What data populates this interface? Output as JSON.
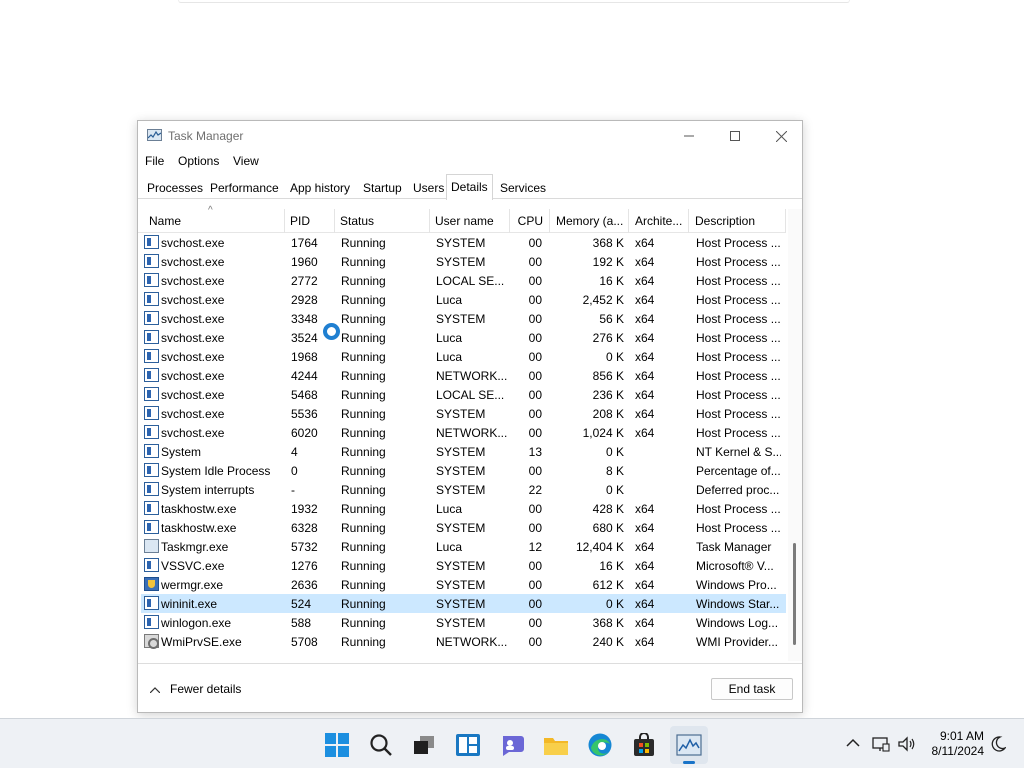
{
  "window": {
    "title": "Task Manager",
    "caption_buttons": [
      "minimize",
      "maximize",
      "close"
    ]
  },
  "menu": [
    "File",
    "Options",
    "View"
  ],
  "tabs": [
    {
      "label": "Processes"
    },
    {
      "label": "Performance"
    },
    {
      "label": "App history"
    },
    {
      "label": "Startup"
    },
    {
      "label": "Users"
    },
    {
      "label": "Details",
      "active": true
    },
    {
      "label": "Services"
    }
  ],
  "columns": [
    "Name",
    "PID",
    "Status",
    "User name",
    "CPU",
    "Memory (a...",
    "Archite...",
    "Description"
  ],
  "rows": [
    {
      "name": "svchost.exe",
      "pid": "1764",
      "status": "Running",
      "user": "SYSTEM",
      "cpu": "00",
      "memory": "368 K",
      "arch": "x64",
      "desc": "Host Process ...",
      "icon": "window-icon"
    },
    {
      "name": "svchost.exe",
      "pid": "1960",
      "status": "Running",
      "user": "SYSTEM",
      "cpu": "00",
      "memory": "192 K",
      "arch": "x64",
      "desc": "Host Process ...",
      "icon": "window-icon"
    },
    {
      "name": "svchost.exe",
      "pid": "2772",
      "status": "Running",
      "user": "LOCAL SE...",
      "cpu": "00",
      "memory": "16 K",
      "arch": "x64",
      "desc": "Host Process ...",
      "icon": "window-icon"
    },
    {
      "name": "svchost.exe",
      "pid": "2928",
      "status": "Running",
      "user": "Luca",
      "cpu": "00",
      "memory": "2,452 K",
      "arch": "x64",
      "desc": "Host Process ...",
      "icon": "window-icon"
    },
    {
      "name": "svchost.exe",
      "pid": "3348",
      "status": "Running",
      "user": "SYSTEM",
      "cpu": "00",
      "memory": "56 K",
      "arch": "x64",
      "desc": "Host Process ...",
      "icon": "window-icon"
    },
    {
      "name": "svchost.exe",
      "pid": "3524",
      "status": "Running",
      "user": "Luca",
      "cpu": "00",
      "memory": "276 K",
      "arch": "x64",
      "desc": "Host Process ...",
      "icon": "window-icon"
    },
    {
      "name": "svchost.exe",
      "pid": "1968",
      "status": "Running",
      "user": "Luca",
      "cpu": "00",
      "memory": "0 K",
      "arch": "x64",
      "desc": "Host Process ...",
      "icon": "window-icon"
    },
    {
      "name": "svchost.exe",
      "pid": "4244",
      "status": "Running",
      "user": "NETWORK...",
      "cpu": "00",
      "memory": "856 K",
      "arch": "x64",
      "desc": "Host Process ...",
      "icon": "window-icon"
    },
    {
      "name": "svchost.exe",
      "pid": "5468",
      "status": "Running",
      "user": "LOCAL SE...",
      "cpu": "00",
      "memory": "236 K",
      "arch": "x64",
      "desc": "Host Process ...",
      "icon": "window-icon"
    },
    {
      "name": "svchost.exe",
      "pid": "5536",
      "status": "Running",
      "user": "SYSTEM",
      "cpu": "00",
      "memory": "208 K",
      "arch": "x64",
      "desc": "Host Process ...",
      "icon": "window-icon"
    },
    {
      "name": "svchost.exe",
      "pid": "6020",
      "status": "Running",
      "user": "NETWORK...",
      "cpu": "00",
      "memory": "1,024 K",
      "arch": "x64",
      "desc": "Host Process ...",
      "icon": "window-icon"
    },
    {
      "name": "System",
      "pid": "4",
      "status": "Running",
      "user": "SYSTEM",
      "cpu": "13",
      "memory": "0 K",
      "arch": "",
      "desc": "NT Kernel & S...",
      "icon": "window-icon"
    },
    {
      "name": "System Idle Process",
      "pid": "0",
      "status": "Running",
      "user": "SYSTEM",
      "cpu": "00",
      "memory": "8 K",
      "arch": "",
      "desc": "Percentage of...",
      "icon": "window-icon"
    },
    {
      "name": "System interrupts",
      "pid": "-",
      "status": "Running",
      "user": "SYSTEM",
      "cpu": "22",
      "memory": "0 K",
      "arch": "",
      "desc": "Deferred proc...",
      "icon": "window-icon"
    },
    {
      "name": "taskhostw.exe",
      "pid": "1932",
      "status": "Running",
      "user": "Luca",
      "cpu": "00",
      "memory": "428 K",
      "arch": "x64",
      "desc": "Host Process ...",
      "icon": "window-icon"
    },
    {
      "name": "taskhostw.exe",
      "pid": "6328",
      "status": "Running",
      "user": "SYSTEM",
      "cpu": "00",
      "memory": "680 K",
      "arch": "x64",
      "desc": "Host Process ...",
      "icon": "window-icon"
    },
    {
      "name": "Taskmgr.exe",
      "pid": "5732",
      "status": "Running",
      "user": "Luca",
      "cpu": "12",
      "memory": "12,404 K",
      "arch": "x64",
      "desc": "Task Manager",
      "icon": "graph-icon"
    },
    {
      "name": "VSSVC.exe",
      "pid": "1276",
      "status": "Running",
      "user": "SYSTEM",
      "cpu": "00",
      "memory": "16 K",
      "arch": "x64",
      "desc": "Microsoft® V...",
      "icon": "window-icon"
    },
    {
      "name": "wermgr.exe",
      "pid": "2636",
      "status": "Running",
      "user": "SYSTEM",
      "cpu": "00",
      "memory": "612 K",
      "arch": "x64",
      "desc": "Windows Pro...",
      "icon": "shield-icon"
    },
    {
      "name": "wininit.exe",
      "pid": "524",
      "status": "Running",
      "user": "SYSTEM",
      "cpu": "00",
      "memory": "0 K",
      "arch": "x64",
      "desc": "Windows Star...",
      "icon": "window-icon",
      "selected": true
    },
    {
      "name": "winlogon.exe",
      "pid": "588",
      "status": "Running",
      "user": "SYSTEM",
      "cpu": "00",
      "memory": "368 K",
      "arch": "x64",
      "desc": "Windows Log...",
      "icon": "window-icon"
    },
    {
      "name": "WmiPrvSE.exe",
      "pid": "5708",
      "status": "Running",
      "user": "NETWORK...",
      "cpu": "00",
      "memory": "240 K",
      "arch": "x64",
      "desc": "WMI Provider...",
      "icon": "gear-icon"
    }
  ],
  "footer": {
    "fewer_details": "Fewer details",
    "end_task": "End task"
  },
  "taskbar": {
    "icons": [
      "windows-start-icon",
      "search-icon",
      "task-view-icon",
      "widgets-icon",
      "chat-icon",
      "file-explorer-icon",
      "edge-icon",
      "store-icon",
      "task-manager-icon"
    ],
    "active": "task-manager-icon",
    "tray_icons": [
      "chevron-up-icon",
      "network-icon",
      "volume-icon",
      "focus-moon-icon"
    ]
  },
  "clock": {
    "time": "9:01 AM",
    "date": "8/11/2024"
  },
  "colors": {
    "selection": "#cce8ff",
    "spinner": "#1f7fd1",
    "taskbar": "#eef1f5"
  }
}
